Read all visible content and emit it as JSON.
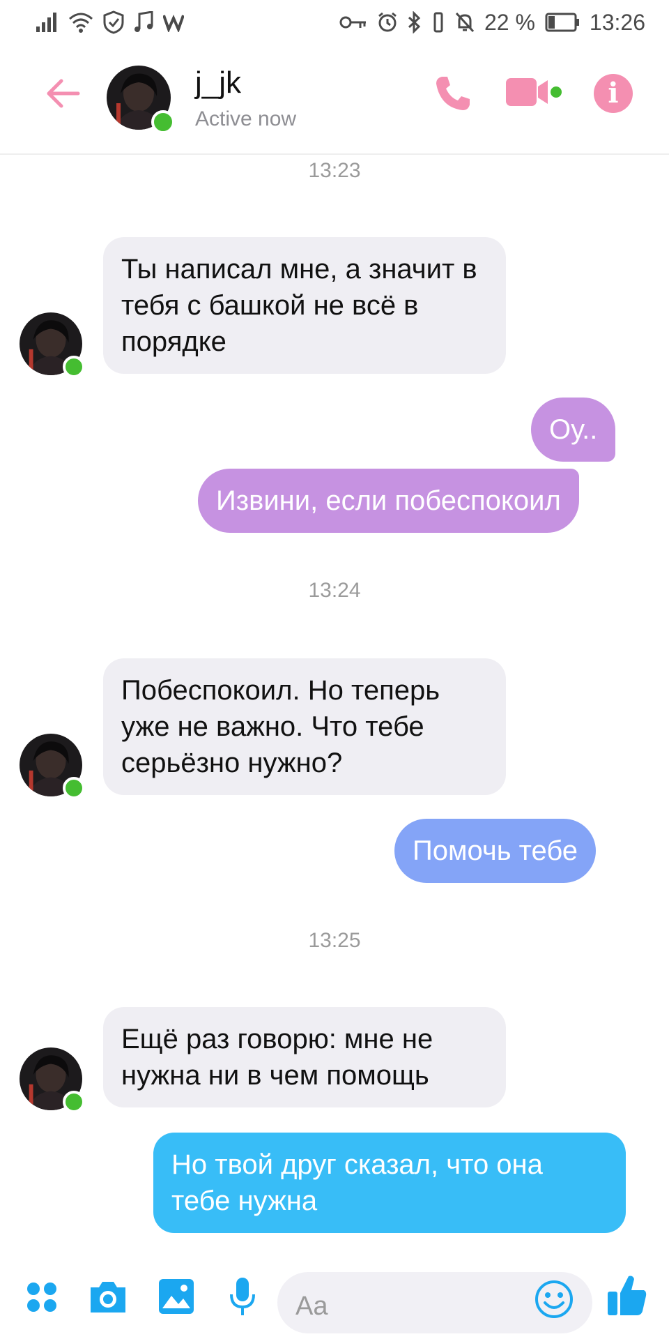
{
  "status_bar": {
    "battery": "22 %",
    "time": "13:26"
  },
  "header": {
    "contact_name": "j_jk",
    "status": "Active now"
  },
  "messages": [
    {
      "type": "time",
      "text": "13:23"
    },
    {
      "type": "in",
      "text": "Ты написал мне, а значит в тебя с башкой не всё в порядке"
    },
    {
      "type": "out",
      "text": "Оу..",
      "color": "#c692e1"
    },
    {
      "type": "out",
      "text": "Извини, если побеспокоил",
      "color": "#c692e1"
    },
    {
      "type": "time",
      "text": "13:24"
    },
    {
      "type": "in",
      "text": "Побеспокоил. Но теперь уже не важно. Что тебе серьёзно нужно?"
    },
    {
      "type": "out",
      "text": "Помочь тебе",
      "color": "#84a4f7"
    },
    {
      "type": "time",
      "text": "13:25"
    },
    {
      "type": "in",
      "text": "Ещё раз говорю: мне не нужна ни в чем помощь"
    },
    {
      "type": "out",
      "text": "Но твой друг сказал, что она тебе нужна",
      "color": "#38bdf7"
    }
  ],
  "composer": {
    "placeholder": "Aa",
    "icons": [
      "apps-icon",
      "camera-icon",
      "gallery-icon",
      "microphone-icon",
      "emoji-icon",
      "thumbs-up-icon"
    ]
  },
  "colors": {
    "header_accent": "#f48fb1",
    "composer_accent": "#1ba7f0",
    "online": "#45bd31"
  }
}
